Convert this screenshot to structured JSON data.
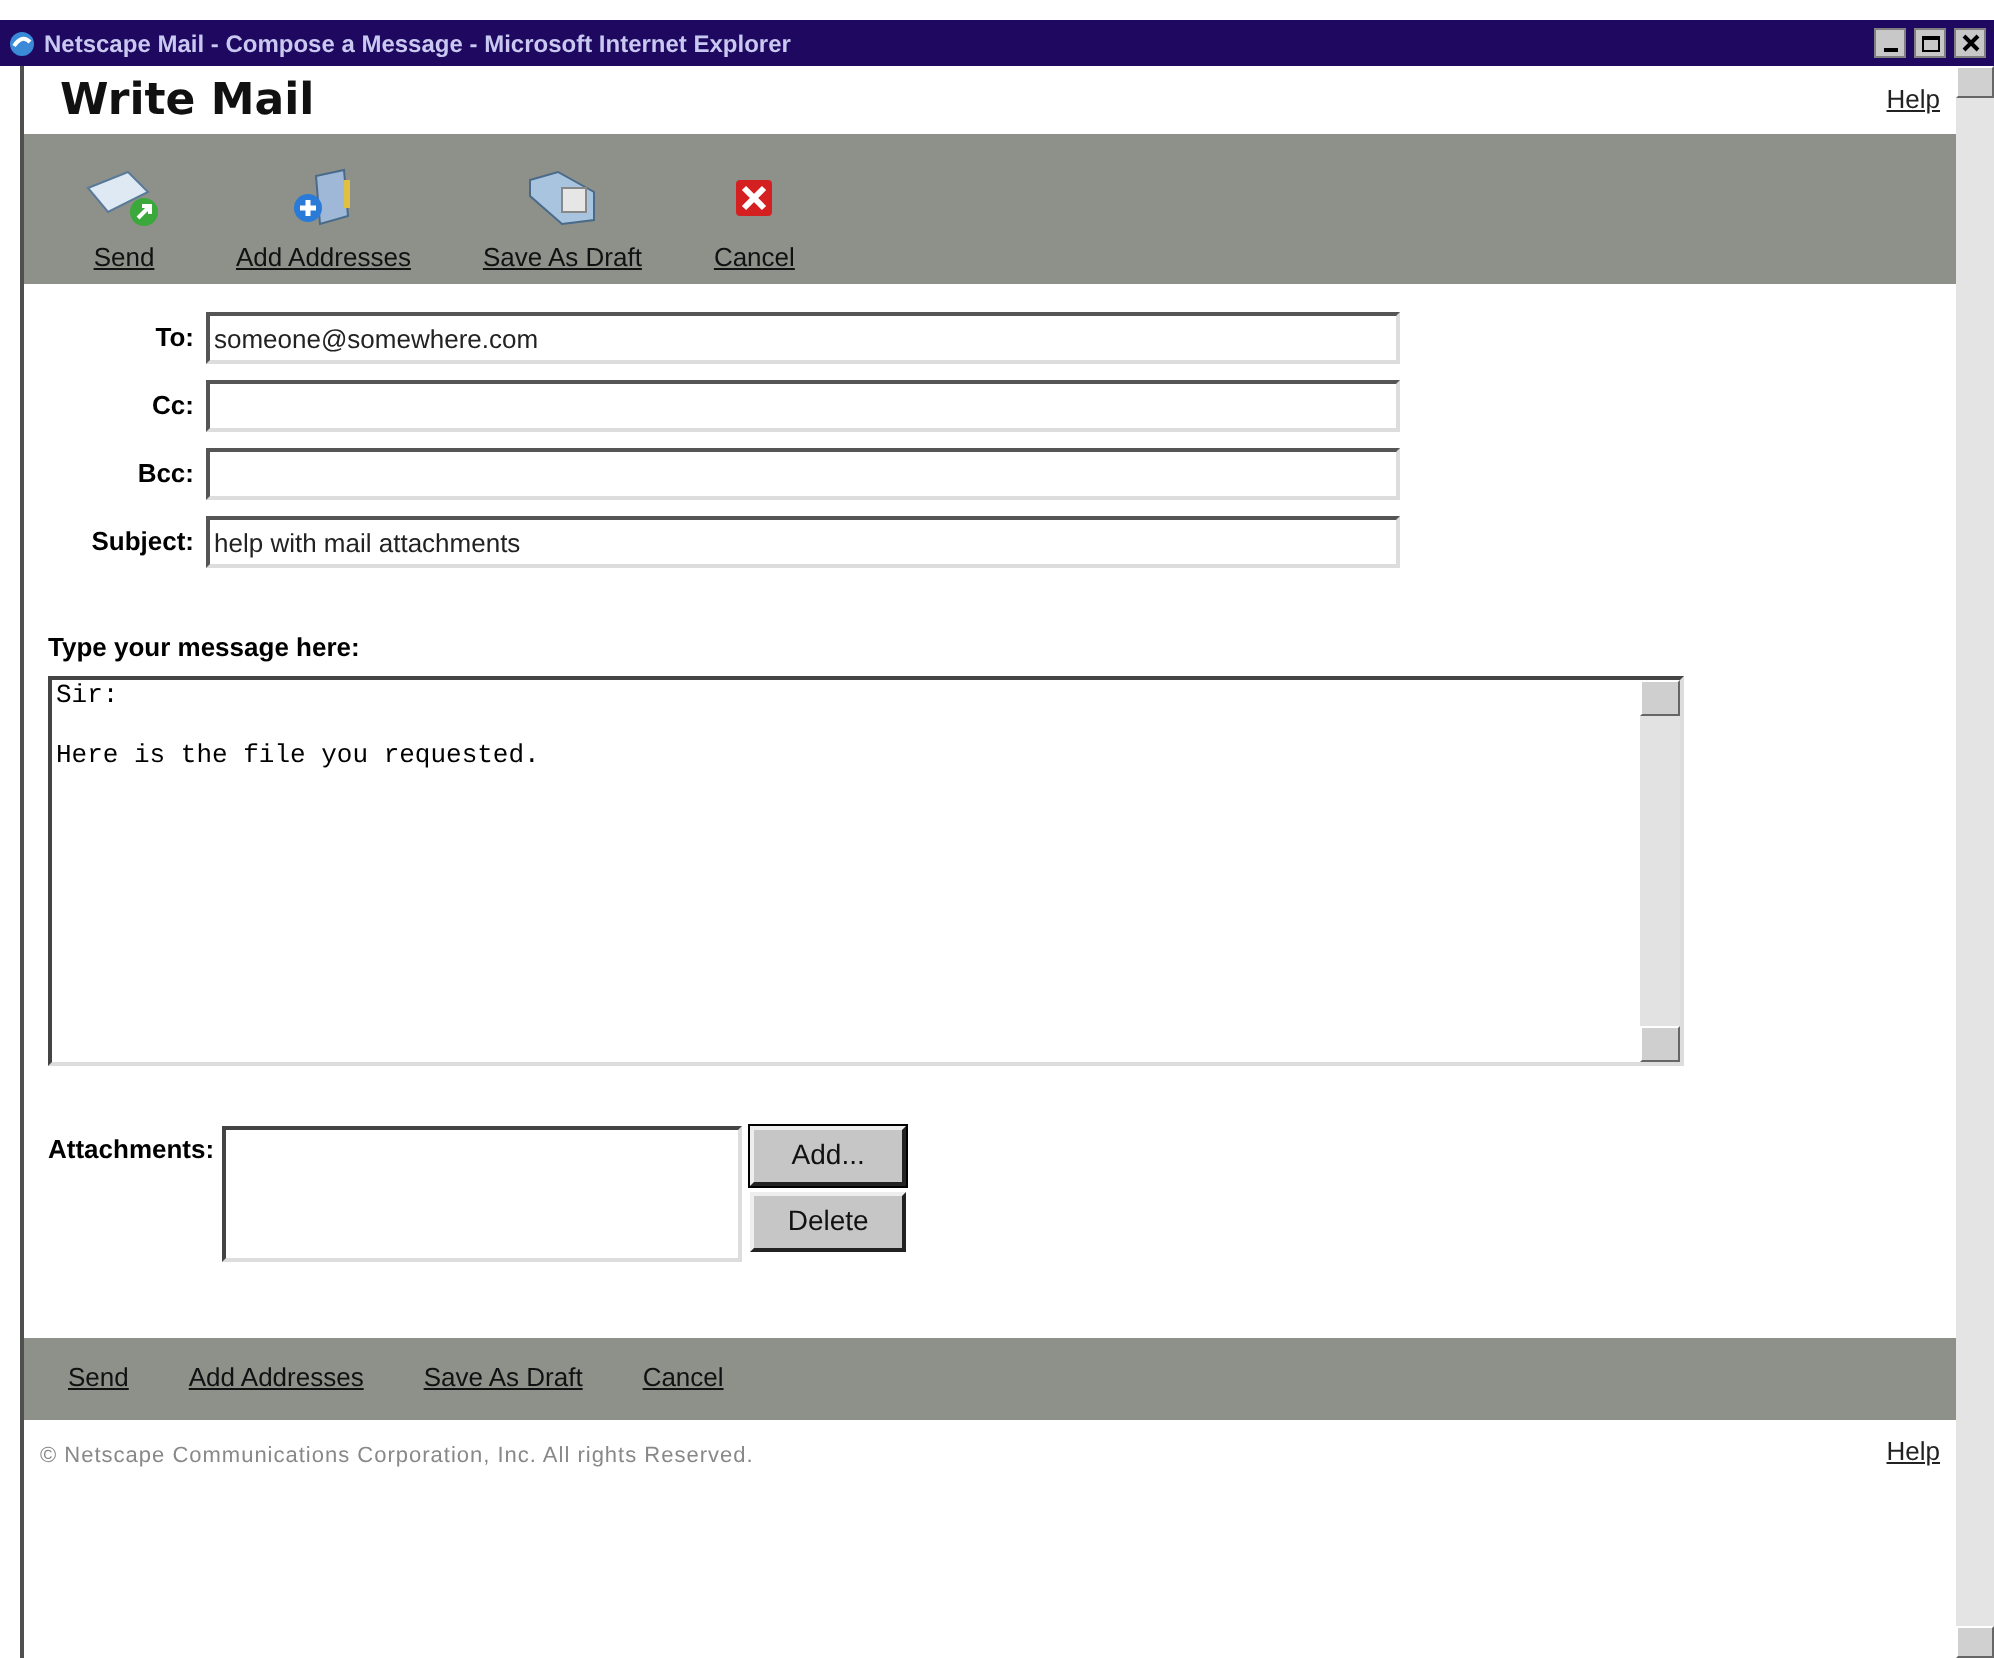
{
  "window": {
    "title": "Netscape Mail - Compose a Message - Microsoft Internet Explorer"
  },
  "header": {
    "title": "Write Mail",
    "help": "Help"
  },
  "toolbar": [
    {
      "kind": "send",
      "label": "Send"
    },
    {
      "kind": "addresses",
      "label": "Add Addresses"
    },
    {
      "kind": "draft",
      "label": "Save As Draft"
    },
    {
      "kind": "cancel",
      "label": "Cancel"
    }
  ],
  "fields": [
    {
      "label": "To:",
      "value": "someone@somewhere.com"
    },
    {
      "label": "Cc:"
    },
    {
      "label": "Bcc:"
    },
    {
      "label": "Subject:",
      "value": "help with mail attachments"
    }
  ],
  "message": {
    "label": "Type your message here:",
    "value": "Sir:\n\nHere is the file you requested."
  },
  "attachments": {
    "label": "Attachments:",
    "buttons": [
      "Add...",
      "Delete"
    ]
  },
  "bottom_links": [
    "Send",
    "Add Addresses",
    "Save As Draft",
    "Cancel"
  ],
  "footer": {
    "copyright": "© Netscape Communications Corporation, Inc. All rights Reserved.",
    "help": "Help"
  }
}
